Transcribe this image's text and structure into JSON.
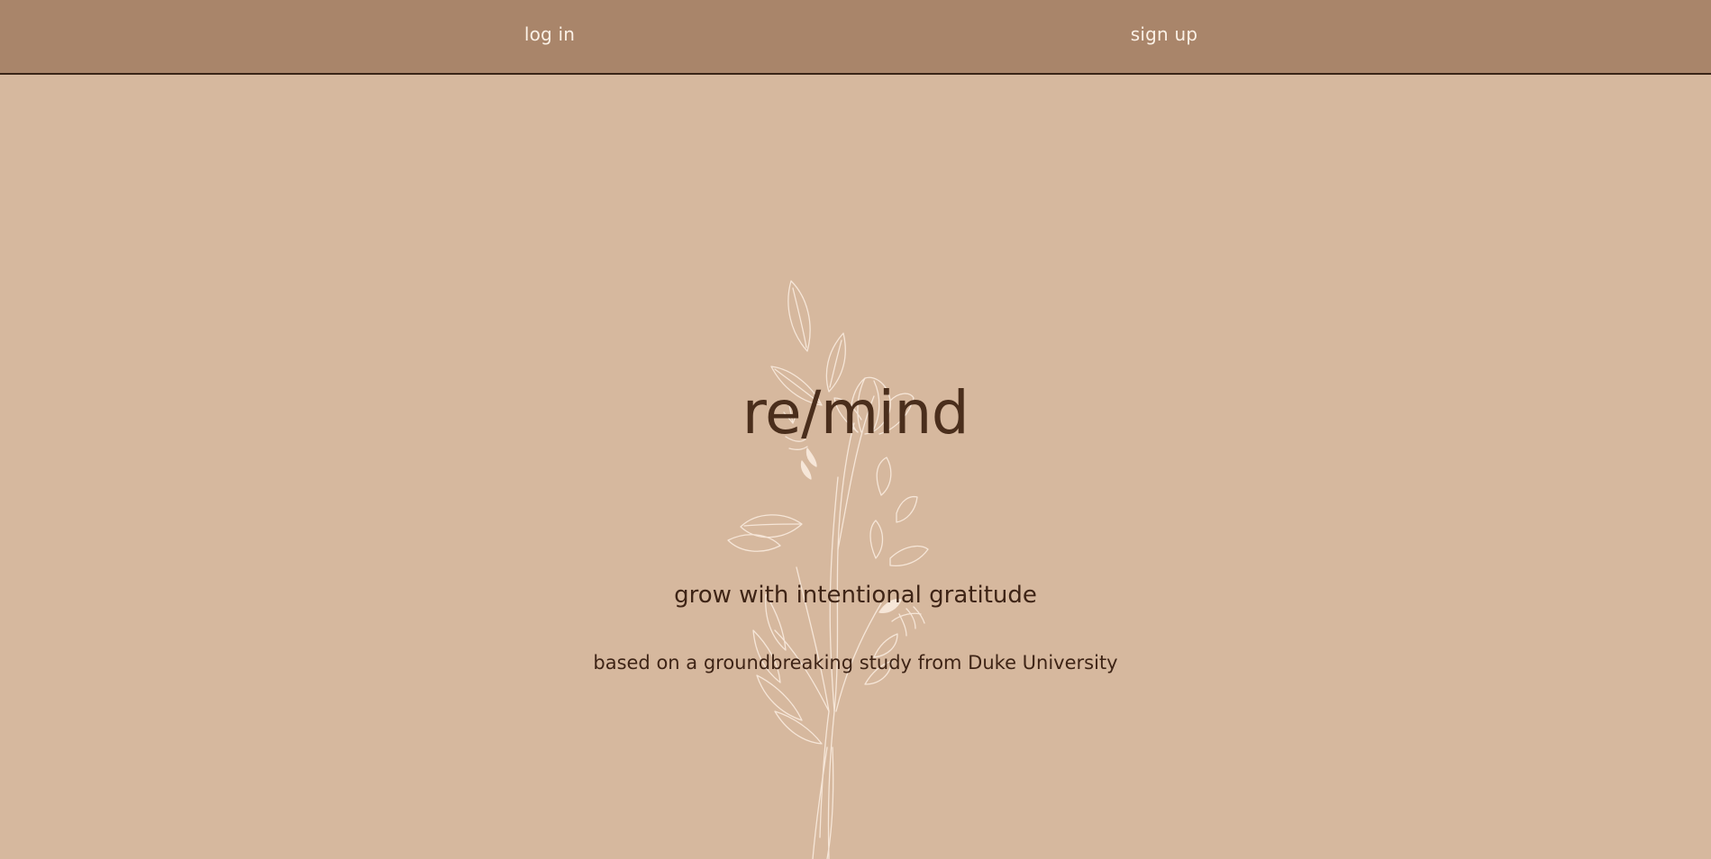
{
  "nav": {
    "login_label": "log in",
    "signup_label": "sign up"
  },
  "hero": {
    "title": "re/mind",
    "tagline": "grow with intentional gratitude",
    "study_note": "based on a groundbreaking study from Duke University",
    "illustration_icon": "botanical-line-art-icon"
  },
  "colors": {
    "background": "#d6b89e",
    "navbar": "#a9856a",
    "nav_text": "#fbf1e6",
    "title_text": "#4a2e1c",
    "body_text": "#3e2416",
    "illustration_stroke": "#f6e6d8"
  }
}
